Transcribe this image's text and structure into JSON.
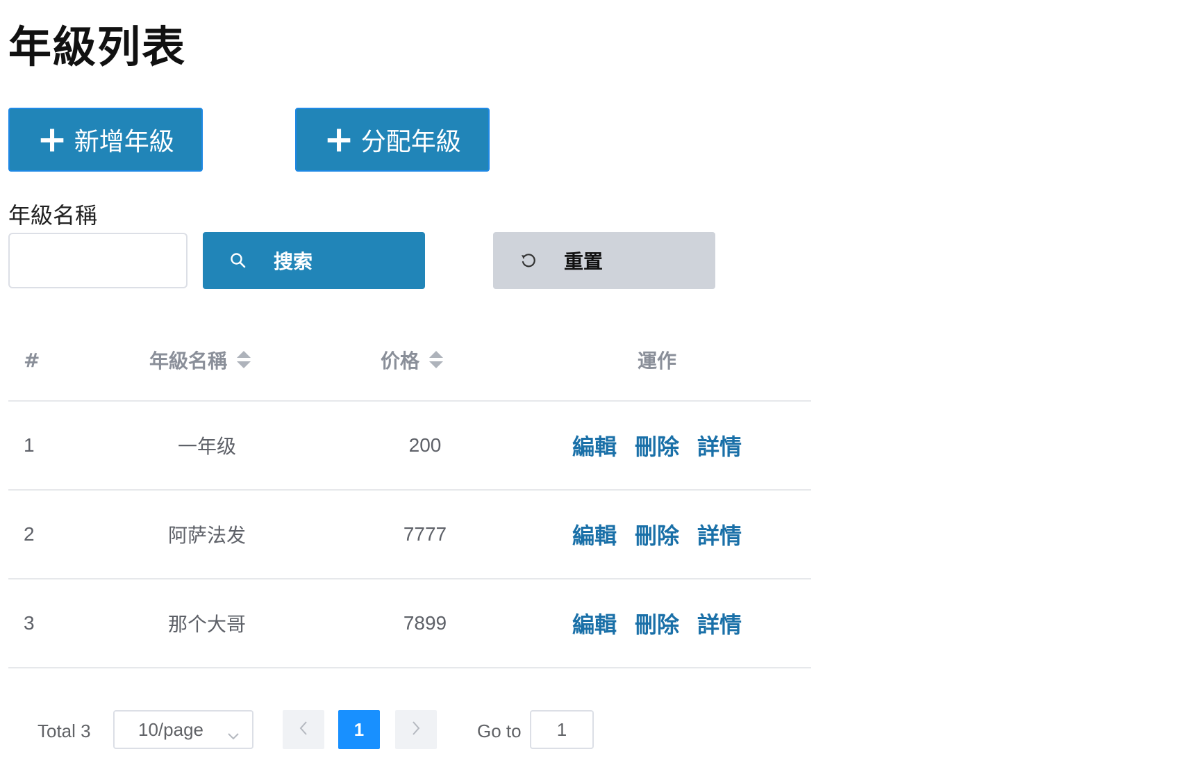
{
  "page": {
    "title": "年級列表"
  },
  "toolbar": {
    "add_grade_label": "新增年級",
    "assign_grade_label": "分配年級",
    "plus_glyph": "+"
  },
  "filter": {
    "grade_name_label": "年級名稱",
    "grade_name_value": "",
    "search_label": "搜索",
    "reset_label": "重置"
  },
  "table": {
    "columns": {
      "index": "#",
      "grade_name": "年級名稱",
      "price": "价格",
      "actions": "運作"
    },
    "action_labels": {
      "edit": "編輯",
      "delete": "刪除",
      "details": "詳情"
    },
    "rows": [
      {
        "index": "1",
        "grade_name": "一年级",
        "price": "200"
      },
      {
        "index": "2",
        "grade_name": "阿萨法发",
        "price": "7777"
      },
      {
        "index": "3",
        "grade_name": "那个大哥",
        "price": "7899"
      }
    ]
  },
  "pagination": {
    "total_text": "Total 3",
    "page_size": "10/page",
    "current_page": "1",
    "goto_label": "Go to",
    "goto_value": "1"
  },
  "colors": {
    "primary": "#2185b8",
    "reset_bg": "#cfd3da",
    "link": "#1a70a8",
    "active_page": "#1890ff"
  }
}
